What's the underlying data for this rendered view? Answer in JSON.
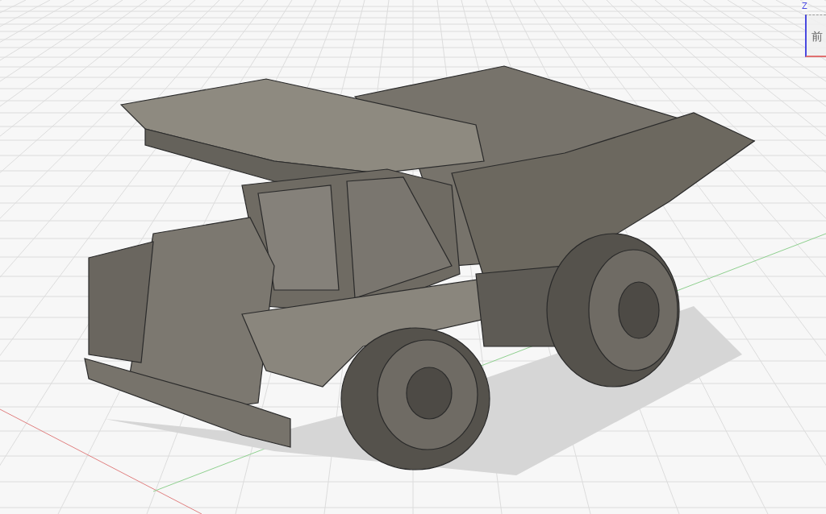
{
  "viewcube": {
    "axis_label": "Z",
    "face_label": "前"
  }
}
